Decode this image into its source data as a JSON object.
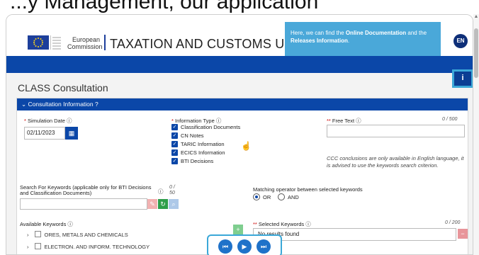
{
  "caption": "...y Management, our application",
  "header": {
    "commission_line1": "European",
    "commission_line2": "Commission",
    "title": "TAXATION AND CUSTOMS UNION",
    "info_prefix": "Here, we can find the ",
    "info_bold1": "Online Documentation",
    "info_mid": " and the ",
    "info_bold2": "Releases Information",
    "info_suffix": ".",
    "lang": "EN",
    "info_btn": "i"
  },
  "page_title": "CLASS Consultation",
  "section": {
    "title": "Consultation Information",
    "help": "?"
  },
  "simulation_date": {
    "label": "Simulation Date",
    "value": "02/11/2023"
  },
  "information_type": {
    "label": "Information Type",
    "options": [
      {
        "label": "Classification Documents",
        "checked": true
      },
      {
        "label": "CN Notes",
        "checked": true
      },
      {
        "label": "TARIC Information",
        "checked": true
      },
      {
        "label": "ECICS Information",
        "checked": true
      },
      {
        "label": "BTI Decisions",
        "checked": true
      }
    ]
  },
  "free_text": {
    "label": "Free Text",
    "counter": "0 / 500",
    "value": "",
    "note": "CCC conclusions are only available in English language, it is advised to use the keywords search criterion."
  },
  "keyword_search": {
    "label_line1": "Search For Keywords (applicable only for BTI Decisions",
    "label_line2": "and Classification Documents)",
    "counter_top": "0 /",
    "counter_bottom": "50",
    "value": ""
  },
  "matching": {
    "label": "Matching operator between selected keywords",
    "options": [
      {
        "label": "OR",
        "selected": true
      },
      {
        "label": "AND",
        "selected": false
      }
    ]
  },
  "available_keywords": {
    "label": "Available Keywords",
    "items": [
      {
        "label": "ORES, METALS AND CHEMICALS"
      },
      {
        "label": "ELECTRON. AND INFORM. TECHNOLOGY"
      }
    ]
  },
  "selected_keywords": {
    "label": "Selected Keywords",
    "counter": "0 / 200",
    "empty_text": "No results found"
  },
  "colors": {
    "brand_blue": "#0b47a8",
    "info_blue": "#4aa8d9",
    "highlight": "#3ba8d8"
  },
  "icons": {
    "calendar": "calendar-icon",
    "eraser": "eraser-icon",
    "refresh": "refresh-icon",
    "search": "search-icon",
    "add": "plus-icon",
    "remove": "minus-icon",
    "media_prev": "skip-back-icon",
    "media_play": "play-icon",
    "media_next": "skip-forward-icon"
  }
}
